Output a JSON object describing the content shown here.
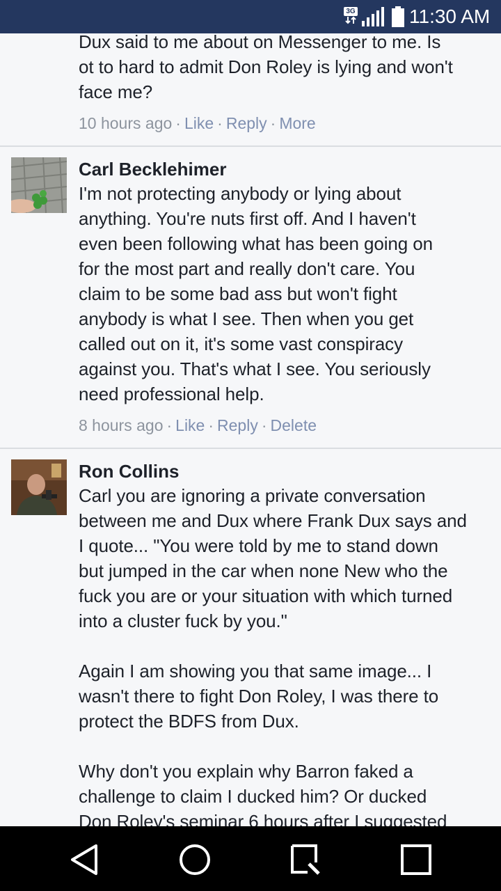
{
  "status_bar": {
    "network": "3G",
    "time": "11:30 AM",
    "icons": [
      "network-3g-icon",
      "signal-icon",
      "battery-icon"
    ]
  },
  "comments": [
    {
      "name": "",
      "text": "Dux said to me about on Messenger to me. Is\not to hard to admit Don Roley is lying and won't\nface me?",
      "time": "10 hours ago",
      "actions": [
        "Like",
        "Reply",
        "More"
      ]
    },
    {
      "name": "Carl Becklehimer",
      "text": "I'm not protecting anybody or lying about\nanything. You're nuts first off. And I haven't\neven been following what has been going on\nfor the most part and really don't care. You\nclaim to be some bad ass but won't fight\nanybody is what I see. Then when you get\ncalled out on it, it's some vast conspiracy\nagainst you. That's what I see. You seriously\nneed professional help.",
      "time": "8 hours ago",
      "actions": [
        "Like",
        "Reply",
        "Delete"
      ]
    },
    {
      "name": "Ron Collins",
      "text": "Carl you are ignoring a private conversation\nbetween me and Dux where Frank Dux says and\nI quote... \"You were told by me to stand down\nbut jumped in the car when none New who the\nfuck you are or your situation with which turned\ninto a cluster fuck by you.\"\n\nAgain I am showing you that same image... I\nwasn't there to fight Don Roley, I was there to\nprotect the BDFS from Dux.\n\nWhy don't you explain why Barron faked a\nchallenge to claim I ducked him? Or ducked\nDon Roley's seminar 6 hours after I suggested"
    }
  ],
  "nav_bar": {
    "buttons": [
      "back-icon",
      "home-icon",
      "search-icon",
      "recent-apps-icon"
    ]
  },
  "colors": {
    "status_bar_bg": "#24375f",
    "feed_bg": "#f6f7f9",
    "text": "#1d2129",
    "meta": "#8d949e",
    "link": "#7f8fb0",
    "divider": "#dadde1"
  }
}
